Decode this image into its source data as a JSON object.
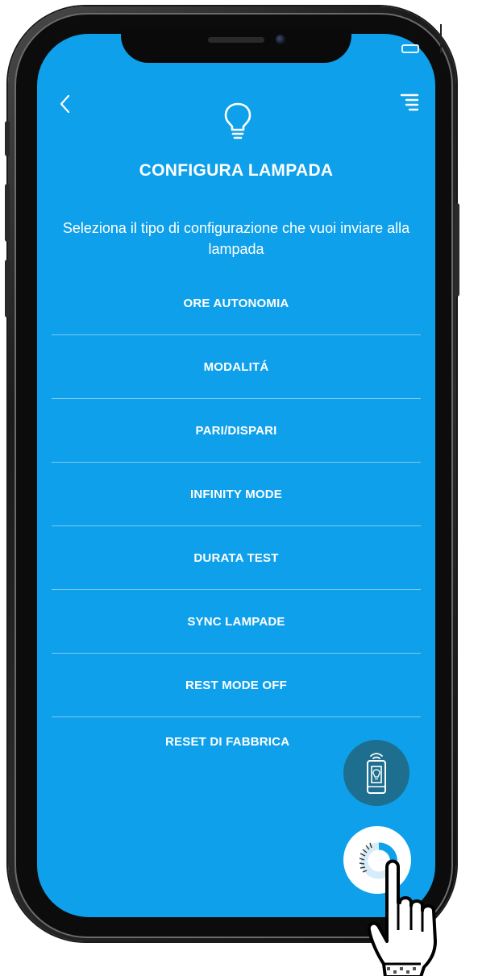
{
  "header": {
    "back_icon": "chevron-left-icon",
    "menu_icon": "menu-icon",
    "screen_icon": "lightbulb-icon",
    "title": "CONFIGURA LAMPADA",
    "subtitle": "Seleziona il tipo di configurazione che vuoi inviare alla lampada"
  },
  "menu": {
    "items": [
      {
        "label": "ORE AUTONOMIA"
      },
      {
        "label": "MODALITÁ"
      },
      {
        "label": "PARI/DISPARI"
      },
      {
        "label": "INFINITY MODE"
      },
      {
        "label": "DURATA TEST"
      },
      {
        "label": "SYNC LAMPADE"
      },
      {
        "label": "REST MODE OFF"
      },
      {
        "label": "RESET DI FABBRICA"
      }
    ]
  },
  "fabs": {
    "remote_icon": "phone-lamp-remote-icon",
    "sync_icon": "sync-progress-icon"
  },
  "colors": {
    "screen_background": "#0ea0ea",
    "remote_fab": "#1e6f8f",
    "text": "#ffffff"
  }
}
